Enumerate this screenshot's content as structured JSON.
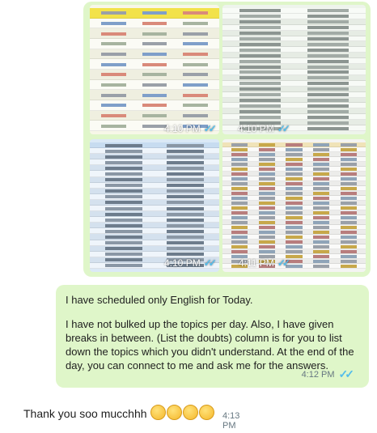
{
  "image_grid": {
    "images": [
      {
        "time": "4:10 PM"
      },
      {
        "time": "4:10 PM"
      },
      {
        "time": "4:10 PM"
      },
      {
        "time": "4:11 PM"
      }
    ]
  },
  "outgoing_message": {
    "paragraphs": [
      "I have scheduled only English for Today.",
      "I have not bulked up the topics per day. Also, I have given breaks in between. (List the doubts) column is for you to list down the topics which you didn't understand. At the end of the day, you can connect to me and ask me for the answers."
    ],
    "time": "4:12 PM",
    "status": "read"
  },
  "incoming_message": {
    "text": "Thank you soo mucchhh",
    "emoji_count": 4,
    "time": "4:13 PM"
  },
  "colors": {
    "outgoing_bubble": "#dff6c9",
    "read_tick": "#53bdeb",
    "timestamp": "#667781"
  }
}
